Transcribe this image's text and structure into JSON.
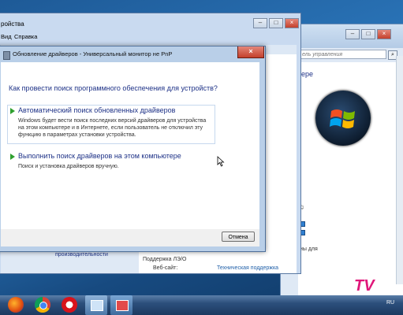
{
  "device_manager": {
    "title": "ройства",
    "menu": [
      "Вид",
      "Справка"
    ]
  },
  "system_window": {
    "search_placeholder": "ель управления",
    "heading": "ере",
    "misc": [
      "©",
      "",
      "",
      "ны для"
    ],
    "left_link": "Счетчики и средства\nпроизводительности",
    "support_heading": "Поддержка ЛЭ/О",
    "web_label": "Веб-сайт:",
    "web_link": "Техническая поддержка"
  },
  "dialog": {
    "title": "Обновление драйверов - Универсальный монитор не PnP",
    "question": "Как провести поиск программного обеспечения для устройств?",
    "options": [
      {
        "title": "Автоматический поиск обновленных драйверов",
        "description": "Windows будет вести поиск последних версий драйверов для устройства на этом компьютере и в Интернете, если пользователь не отключил эту функцию в параметрах установки устройства."
      },
      {
        "title": "Выполнить поиск драйверов на этом компьютере",
        "description": "Поиск и установка драйверов вручную."
      }
    ],
    "cancel_label": "Отмена"
  },
  "taskbar": {
    "language": "RU",
    "apps": [
      "firefox-icon",
      "chrome-icon",
      "opera-icon",
      "network-app-icon",
      "device-app-icon"
    ]
  },
  "watermark": "TV"
}
